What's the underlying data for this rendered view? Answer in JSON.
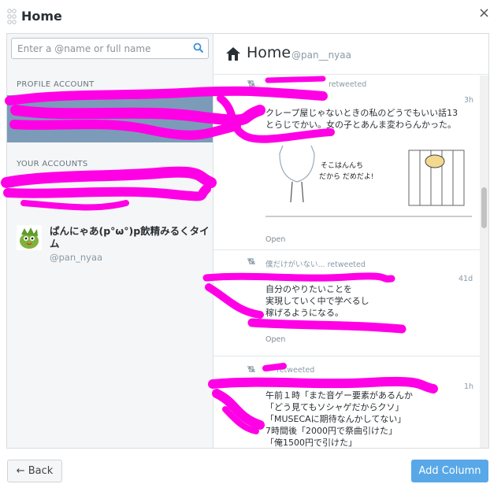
{
  "window": {
    "title": "Home"
  },
  "search": {
    "placeholder": "Enter a @name or full name"
  },
  "sidebar": {
    "profile_label": "PROFILE ACCOUNT",
    "accounts_label": "YOUR ACCOUNTS",
    "account": {
      "name": "ぱんにゃあ(p°ω°)p飲精みるくタイム",
      "handle": "@pan_nyaa"
    }
  },
  "column": {
    "title": "Home",
    "handle": "@pan__nyaa"
  },
  "tweets": [
    {
      "retweet_label": "retweeted",
      "time": "3h",
      "lines": [
        "クレープ屋じゃないときの私のどうでもいい話13",
        "とらじでかい。女の子とあんま変わらんかった。"
      ],
      "media_caption": [
        "そこはんんち",
        "だから だめだよ!"
      ],
      "open": "Open"
    },
    {
      "retweet_label": "僕だけがいない... retweeted",
      "time": "41d",
      "lines": [
        "自分のやりたいことを",
        "実現していく中で学べるし",
        "稼げるようになる。"
      ],
      "open": "Open"
    },
    {
      "retweet_label": "retweeted",
      "time": "1h",
      "lines": [
        "午前１時「また音ゲー要素があるんか",
        "「どう見てもソシャゲだからクソ」",
        "「MUSECAに期待なんかしてない」",
        "7時間後「2000円で祭曲引けた」",
        "「俺1500円で引けた」"
      ]
    }
  ],
  "footer": {
    "back_label": "← Back",
    "add_label": "Add Column"
  },
  "colors": {
    "accent": "#58a8e8",
    "profile_bg": "#7c9bb8",
    "scribble": "#ff00e6"
  }
}
